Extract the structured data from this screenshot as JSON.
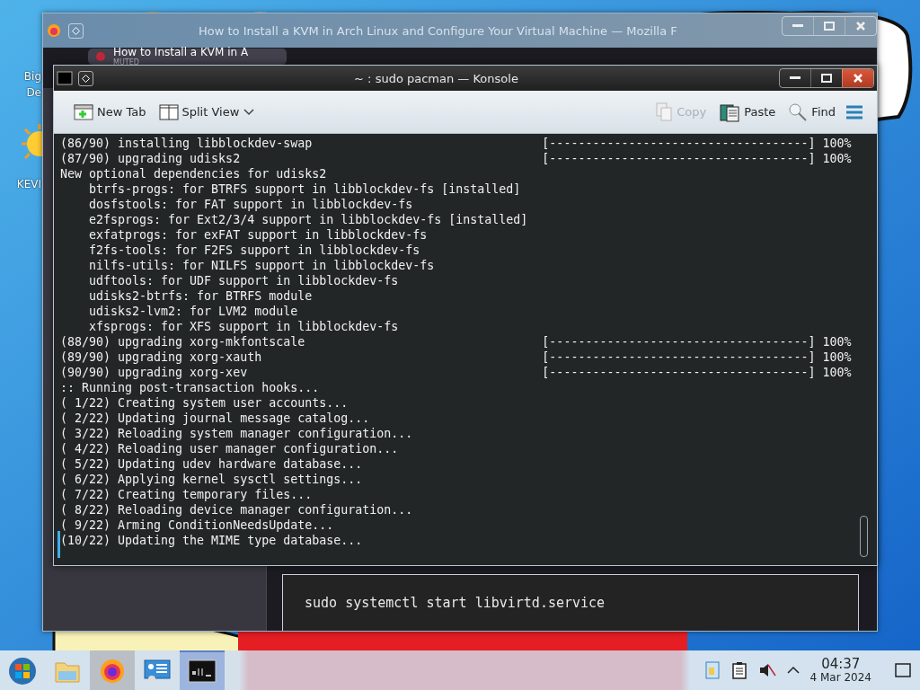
{
  "desktop_icons": [
    {
      "lines": [
        "Big",
        "De"
      ]
    },
    {
      "lines": [
        "KEVI"
      ]
    }
  ],
  "browser": {
    "title": "How to Install a KVM in Arch Linux and Configure Your Virtual Machine — Mozilla F",
    "tab": {
      "title": "How to Install a KVM in A",
      "status": "MUTED"
    },
    "code_block": "sudo systemctl start libvirtd.service"
  },
  "konsole": {
    "title": "~ : sudo pacman — Konsole",
    "toolbar": [
      {
        "kind": "new-tab",
        "label": "New Tab",
        "disabled": false
      },
      {
        "kind": "split-view",
        "label": "Split View",
        "disabled": false
      },
      {
        "kind": "copy",
        "label": "Copy",
        "disabled": true
      },
      {
        "kind": "paste",
        "label": "Paste",
        "disabled": false
      },
      {
        "kind": "find",
        "label": "Find",
        "disabled": false
      }
    ],
    "lines": [
      {
        "text": "(86/90) installing libblockdev-swap",
        "bar": "[------------------------------------]",
        "percent": "100%"
      },
      {
        "text": "(87/90) upgrading udisks2",
        "bar": "[------------------------------------]",
        "percent": "100%"
      },
      {
        "text": "New optional dependencies for udisks2"
      },
      {
        "text": "    btrfs-progs: for BTRFS support in libblockdev-fs [installed]"
      },
      {
        "text": "    dosfstools: for FAT support in libblockdev-fs"
      },
      {
        "text": "    e2fsprogs: for Ext2/3/4 support in libblockdev-fs [installed]"
      },
      {
        "text": "    exfatprogs: for exFAT support in libblockdev-fs"
      },
      {
        "text": "    f2fs-tools: for F2FS support in libblockdev-fs"
      },
      {
        "text": "    nilfs-utils: for NILFS support in libblockdev-fs"
      },
      {
        "text": "    udftools: for UDF support in libblockdev-fs"
      },
      {
        "text": "    udisks2-btrfs: for BTRFS module"
      },
      {
        "text": "    udisks2-lvm2: for LVM2 module"
      },
      {
        "text": "    xfsprogs: for XFS support in libblockdev-fs"
      },
      {
        "text": "(88/90) upgrading xorg-mkfontscale",
        "bar": "[------------------------------------]",
        "percent": "100%"
      },
      {
        "text": "(89/90) upgrading xorg-xauth",
        "bar": "[------------------------------------]",
        "percent": "100%"
      },
      {
        "text": "(90/90) upgrading xorg-xev",
        "bar": "[------------------------------------]",
        "percent": "100%"
      },
      {
        "text": ":: Running post-transaction hooks..."
      },
      {
        "text": "( 1/22) Creating system user accounts..."
      },
      {
        "text": "( 2/22) Updating journal message catalog..."
      },
      {
        "text": "( 3/22) Reloading system manager configuration..."
      },
      {
        "text": "( 4/22) Reloading user manager configuration..."
      },
      {
        "text": "( 5/22) Updating udev hardware database..."
      },
      {
        "text": "( 6/22) Applying kernel sysctl settings..."
      },
      {
        "text": "( 7/22) Creating temporary files..."
      },
      {
        "text": "( 8/22) Reloading device manager configuration..."
      },
      {
        "text": "( 9/22) Arming ConditionNeedsUpdate..."
      },
      {
        "text": "(10/22) Updating the MIME type database..."
      }
    ]
  },
  "taskbar": {
    "apps": [
      {
        "kind": "start",
        "selected": false
      },
      {
        "kind": "files",
        "selected": false
      },
      {
        "kind": "browser",
        "selected": false,
        "hovered": true
      },
      {
        "kind": "settings",
        "selected": false
      },
      {
        "kind": "terminal",
        "selected": true
      }
    ],
    "clock": {
      "time": "04:37",
      "date": "4 Mar 2024"
    }
  }
}
